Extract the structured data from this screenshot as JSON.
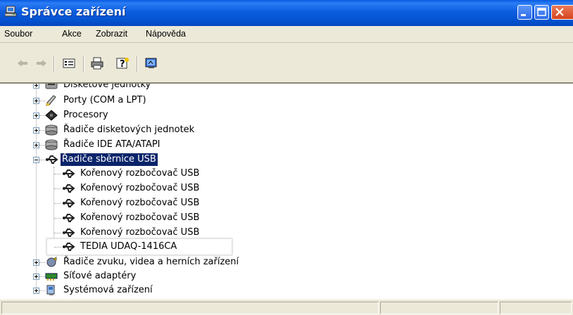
{
  "window": {
    "title": "Správce zařízení",
    "title_icon": "computer-icon",
    "buttons": [
      "minimize",
      "maximize",
      "close"
    ]
  },
  "menu": {
    "items": [
      "Soubor",
      "Akce",
      "Zobrazit",
      "Nápověda"
    ]
  },
  "toolbar": {
    "icons": [
      "back-arrow-icon",
      "forward-arrow-icon",
      "properties-icon",
      "print-icon",
      "help-icon",
      "scan-hardware-icon"
    ]
  },
  "tree": {
    "items": [
      {
        "label": "Disketové jednotky",
        "icon": "floppy-drive-icon",
        "expander": "plus"
      },
      {
        "label": "Porty (COM a LPT)",
        "icon": "port-icon",
        "expander": "plus"
      },
      {
        "label": "Procesory",
        "icon": "processor-icon",
        "expander": "plus"
      },
      {
        "label": "Řadiče disketových jednotek",
        "icon": "controller-icon",
        "expander": "plus"
      },
      {
        "label": "Řadiče IDE ATA/ATAPI",
        "icon": "controller-icon",
        "expander": "plus"
      },
      {
        "label": "Řadiče sběrnice USB",
        "icon": "usb-icon",
        "expander": "minus",
        "selected": true
      },
      {
        "label": "Kořenový rozbočovač USB",
        "icon": "usb-icon",
        "child": true
      },
      {
        "label": "Kořenový rozbočovač USB",
        "icon": "usb-icon",
        "child": true
      },
      {
        "label": "Kořenový rozbočovač USB",
        "icon": "usb-icon",
        "child": true
      },
      {
        "label": "Kořenový rozbočovač USB",
        "icon": "usb-icon",
        "child": true
      },
      {
        "label": "Kořenový rozbočovač USB",
        "icon": "usb-icon",
        "child": true
      },
      {
        "label": "TEDIA UDAQ-1416CA",
        "icon": "usb-icon",
        "child": true,
        "highlighted": true
      },
      {
        "label": "Řadiče zvuku, videa a herních zařízení",
        "icon": "sound-icon",
        "expander": "plus"
      },
      {
        "label": "Síťové adaptéry",
        "icon": "network-adapter-icon",
        "expander": "plus"
      },
      {
        "label": "Systémová zařízení",
        "icon": "system-icon",
        "expander": "plus"
      }
    ]
  },
  "colors": {
    "titlebar": "#0b5ddf",
    "selection": "#0a246a",
    "window_bg": "#ece9d8"
  }
}
